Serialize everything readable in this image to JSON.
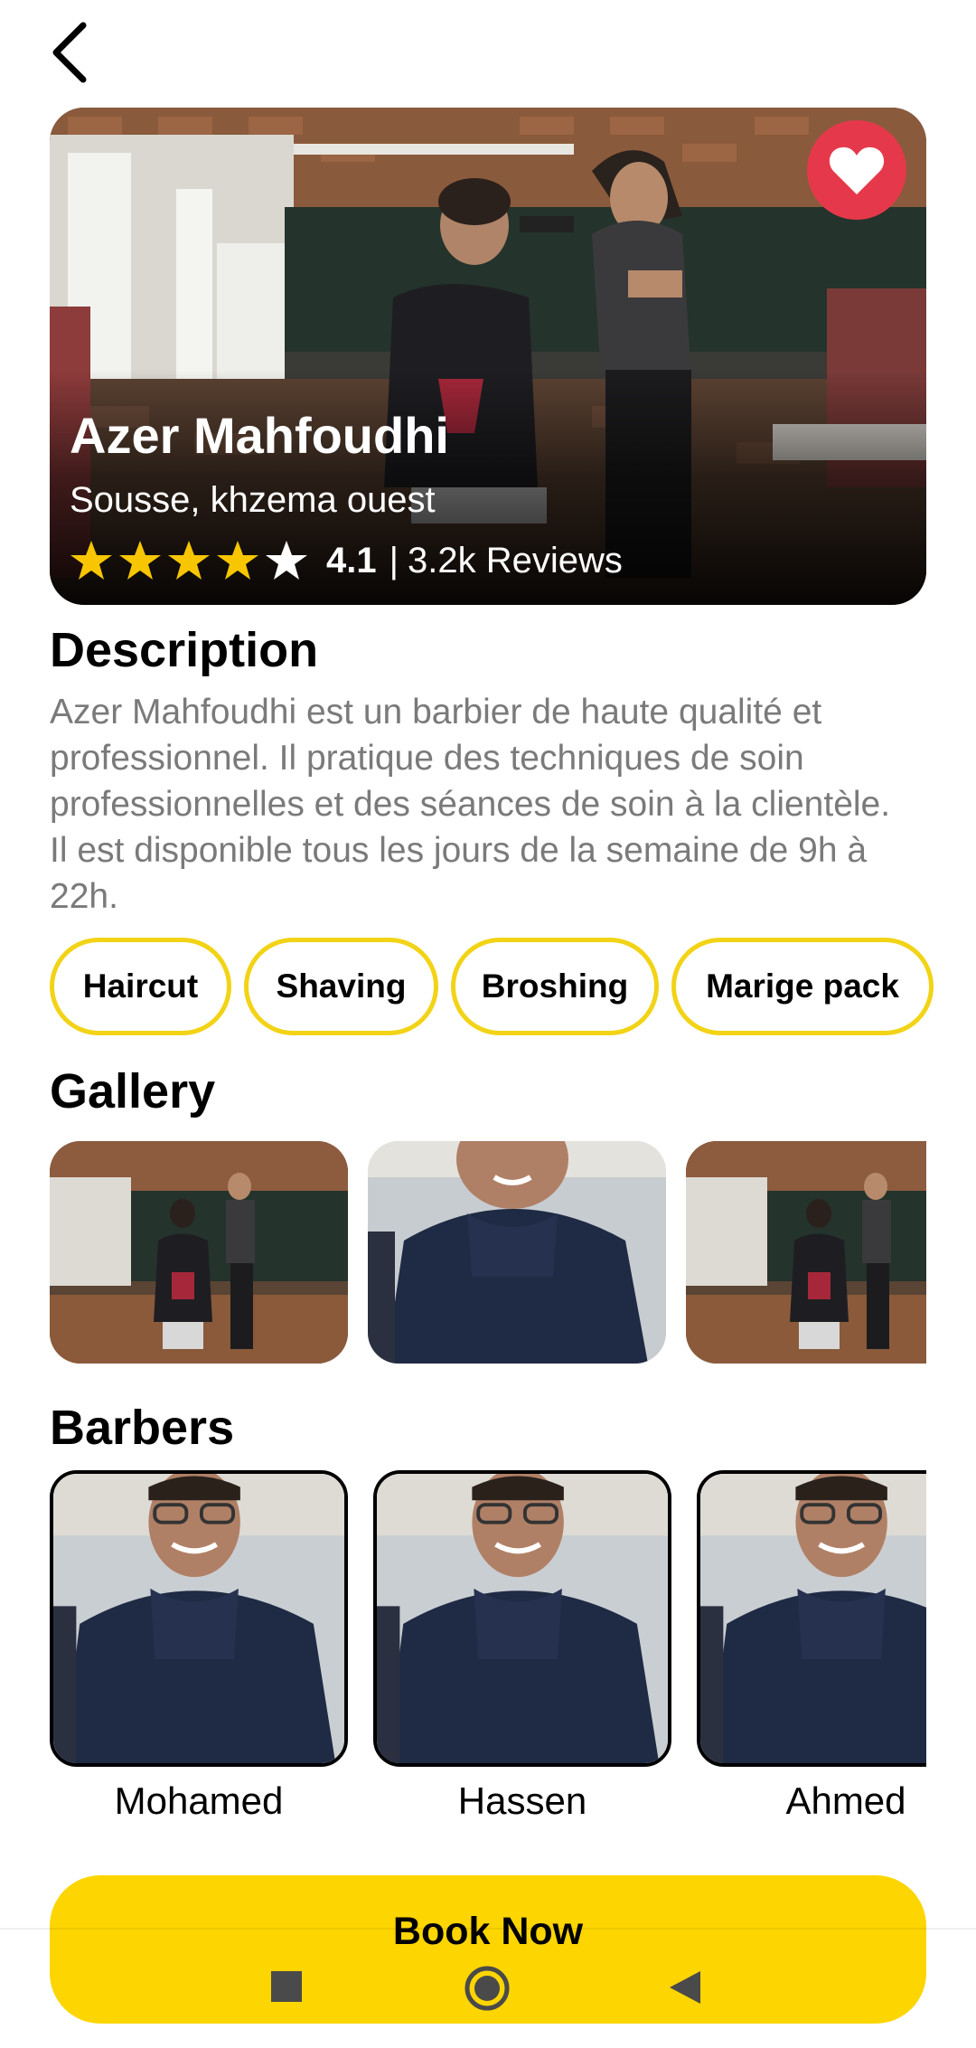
{
  "shop": {
    "name": "Azer Mahfoudhi",
    "location": "Sousse, khzema ouest",
    "rating": "4.1",
    "separator": "|",
    "reviews": "3.2k Reviews",
    "stars_filled": 4,
    "stars_total": 5
  },
  "description": {
    "title": "Description",
    "text": "Azer Mahfoudhi est un barbier de haute qualité et professionnel. Il pratique des techniques de soin professionnelles et des séances de soin à la clientèle. Il est disponible tous les jours de la semaine de 9h à 22h."
  },
  "services": [
    {
      "label": "Haircut"
    },
    {
      "label": "Shaving"
    },
    {
      "label": "Broshing"
    },
    {
      "label": "Marige pack"
    }
  ],
  "gallery": {
    "title": "Gallery"
  },
  "barbers": {
    "title": "Barbers",
    "items": [
      {
        "name": "Mohamed"
      },
      {
        "name": "Hassen"
      },
      {
        "name": "Ahmed"
      }
    ]
  },
  "book_button": {
    "label": "Book Now"
  },
  "colors": {
    "accent": "#fdd500",
    "chip_border": "#f2d316",
    "favorite": "#e5394b",
    "star": "#f7c600",
    "description_text": "#7a7a7a"
  },
  "icons": {
    "back": "chevron-left-icon",
    "favorite": "heart-icon",
    "star": "star-icon",
    "nav_recents": "square-icon",
    "nav_home": "circle-icon",
    "nav_back": "triangle-icon"
  }
}
